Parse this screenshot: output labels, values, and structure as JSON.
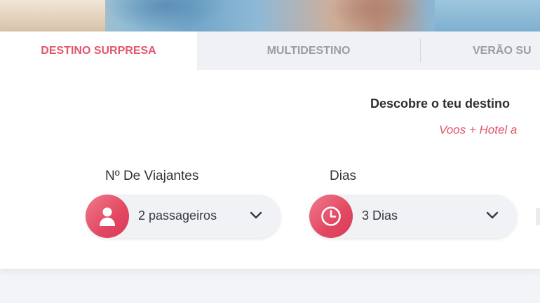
{
  "tabs": [
    {
      "label": "DESTINO SURPRESA",
      "active": true
    },
    {
      "label": "MULTIDESTINO",
      "active": false
    },
    {
      "label": "VERÃO SU",
      "active": false
    }
  ],
  "headline": "Descobre o teu destino",
  "subline": "Voos + Hotel a",
  "travellers": {
    "label": "Nº De Viajantes",
    "value": "2 passageiros",
    "icon": "person-icon"
  },
  "days": {
    "label": "Dias",
    "value": "3 Dias",
    "icon": "clock-icon"
  },
  "colors": {
    "accent": "#e4556b",
    "tab_bg": "#f0f1f5",
    "page_bg": "#f3f4f8"
  }
}
